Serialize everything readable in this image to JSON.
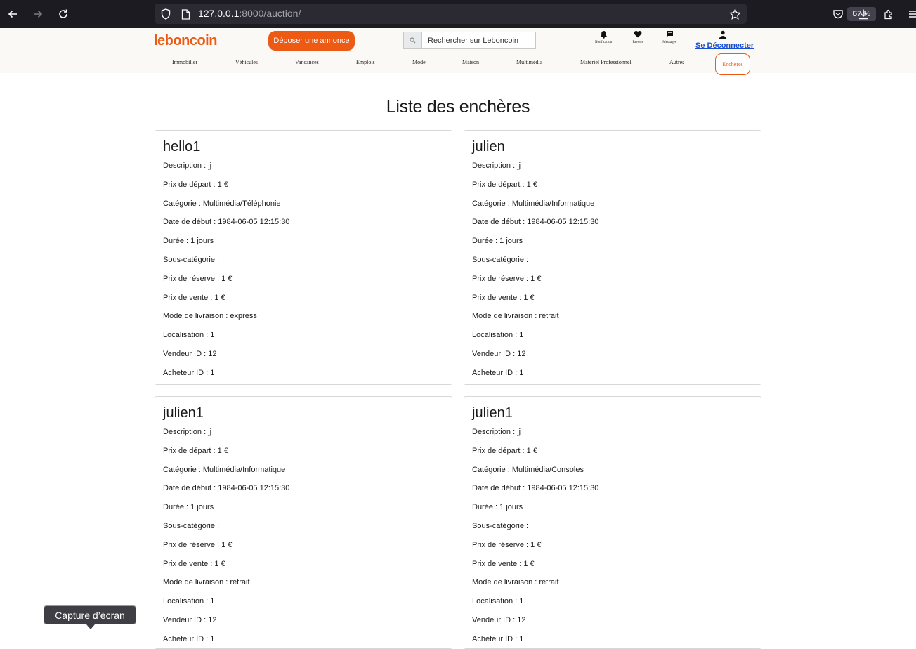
{
  "browser": {
    "url_host": "127.0.0.1",
    "url_rest": ":8000/auction/",
    "zoom": "67 %"
  },
  "header": {
    "logo": "leboncoin",
    "deposit_button": "Déposer une annonce",
    "search_placeholder": "Rechercher sur Leboncoin",
    "icons": {
      "notifications": "Notification",
      "favorites": "Favoris",
      "messages": "Messages"
    },
    "logout": "Se Déconnecter"
  },
  "categories": [
    "Immobilier",
    "Véhicules",
    "Vancances",
    "Emplois",
    "Mode",
    "Maison",
    "Multimédia",
    "Materiel Professionnel",
    "Autres"
  ],
  "active_category": "Enchères",
  "page_title": "Liste des enchères",
  "field_labels": {
    "description": "Description : ",
    "start_price": "Prix de départ : ",
    "category": "Catégorie : ",
    "start_date": "Date de début : ",
    "duration": "Durée : ",
    "subcategory": "Sous-catégorie : ",
    "reserve_price": "Prix de réserve : ",
    "sale_price": "Prix de vente : ",
    "delivery": "Mode de livraison : ",
    "location": "Localisation : ",
    "seller": "Vendeur ID : ",
    "buyer": "Acheteur ID : "
  },
  "auctions": [
    {
      "title": "hello1",
      "description": "jj",
      "start_price": "1 €",
      "category": "Multimédia/Téléphonie",
      "start_date": "1984-06-05 12:15:30",
      "duration": "1 jours",
      "subcategory": "",
      "reserve_price": "1 €",
      "sale_price": "1 €",
      "delivery": "express",
      "location": "1",
      "seller": "12",
      "buyer": "1"
    },
    {
      "title": "julien",
      "description": "jj",
      "start_price": "1 €",
      "category": "Multimédia/Informatique",
      "start_date": "1984-06-05 12:15:30",
      "duration": "1 jours",
      "subcategory": "",
      "reserve_price": "1 €",
      "sale_price": "1 €",
      "delivery": "retrait",
      "location": "1",
      "seller": "12",
      "buyer": "1"
    },
    {
      "title": "julien1",
      "description": "jj",
      "start_price": "1 €",
      "category": "Multimédia/Informatique",
      "start_date": "1984-06-05 12:15:30",
      "duration": "1 jours",
      "subcategory": "",
      "reserve_price": "1 €",
      "sale_price": "1 €",
      "delivery": "retrait",
      "location": "1",
      "seller": "12",
      "buyer": "1"
    },
    {
      "title": "julien1",
      "description": "jj",
      "start_price": "1 €",
      "category": "Multimédia/Consoles",
      "start_date": "1984-06-05 12:15:30",
      "duration": "1 jours",
      "subcategory": "",
      "reserve_price": "1 €",
      "sale_price": "1 €",
      "delivery": "retrait",
      "location": "1",
      "seller": "12",
      "buyer": "1"
    }
  ],
  "tooltip": "Capture d’écran"
}
